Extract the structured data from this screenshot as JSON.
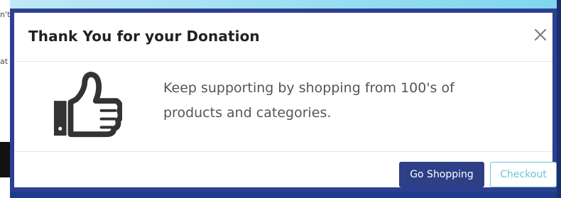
{
  "background": {
    "left_fragments": [
      "n't",
      "at"
    ]
  },
  "modal": {
    "title": "Thank You for your Donation",
    "message_line1": "Keep supporting by shopping from 100's of",
    "message_line2": "products and categories.",
    "buttons": {
      "go_shopping": "Go Shopping",
      "checkout": "Checkout"
    }
  },
  "colors": {
    "modal_border": "#2d3f92",
    "primary_button": "#2d3f86",
    "outline_button": "#6fc4d1"
  },
  "icons": {
    "thumb": "thumbs-up-icon",
    "close": "close-icon"
  }
}
